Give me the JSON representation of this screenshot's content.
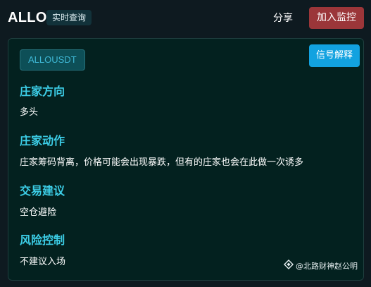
{
  "header": {
    "ticker": "ALLO",
    "mode_badge": "实时查询",
    "share_label": "分享",
    "monitor_label": "加入监控"
  },
  "card": {
    "symbol_tag": "ALLOUSDT",
    "explain_label": "信号解释",
    "sections": [
      {
        "title": "庄家方向",
        "body": "多头"
      },
      {
        "title": "庄家动作",
        "body": "庄家筹码背离，价格可能会出现暴跌，但有的庄家也会在此做一次诱多"
      },
      {
        "title": "交易建议",
        "body": "空仓避险"
      },
      {
        "title": "风险控制",
        "body": "不建议入场"
      }
    ]
  },
  "watermark": {
    "icon": "diamond-logo-icon",
    "text": "@北路财神赵公明"
  },
  "colors": {
    "background": "#0e1a20",
    "card_background": "#03211f",
    "section_title": "#3ccde6",
    "monitor_button": "#9b3639",
    "explain_button": "#12a2e0",
    "symbol_tag_text": "#3fb8d6"
  }
}
